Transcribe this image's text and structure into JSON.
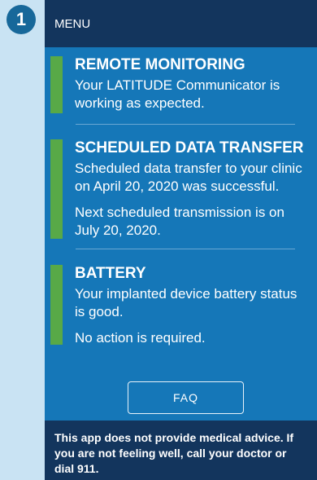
{
  "step": {
    "number": "1"
  },
  "header": {
    "menu_label": "MENU"
  },
  "sections": [
    {
      "title": "REMOTE MONITORING",
      "paragraphs": [
        "Your LATITUDE Communicator is working as expected."
      ]
    },
    {
      "title": "SCHEDULED DATA TRANSFER",
      "paragraphs": [
        "Scheduled data transfer to your clinic on April 20, 2020 was successful.",
        "Next scheduled transmission is on July 20, 2020."
      ]
    },
    {
      "title": "BATTERY",
      "paragraphs": [
        "Your implanted device battery status is good.",
        "No action is required."
      ]
    }
  ],
  "faq_button": {
    "label": "FAQ"
  },
  "footer": {
    "disclaimer": "This app does not provide medical advice. If you are not feeling well, call your doctor or dial 911."
  },
  "colors": {
    "header_bg": "#13355d",
    "body_bg": "#1577b8",
    "accent_green": "#58a947",
    "page_bg": "#c9e3f3",
    "badge_bg": "#17689a"
  }
}
